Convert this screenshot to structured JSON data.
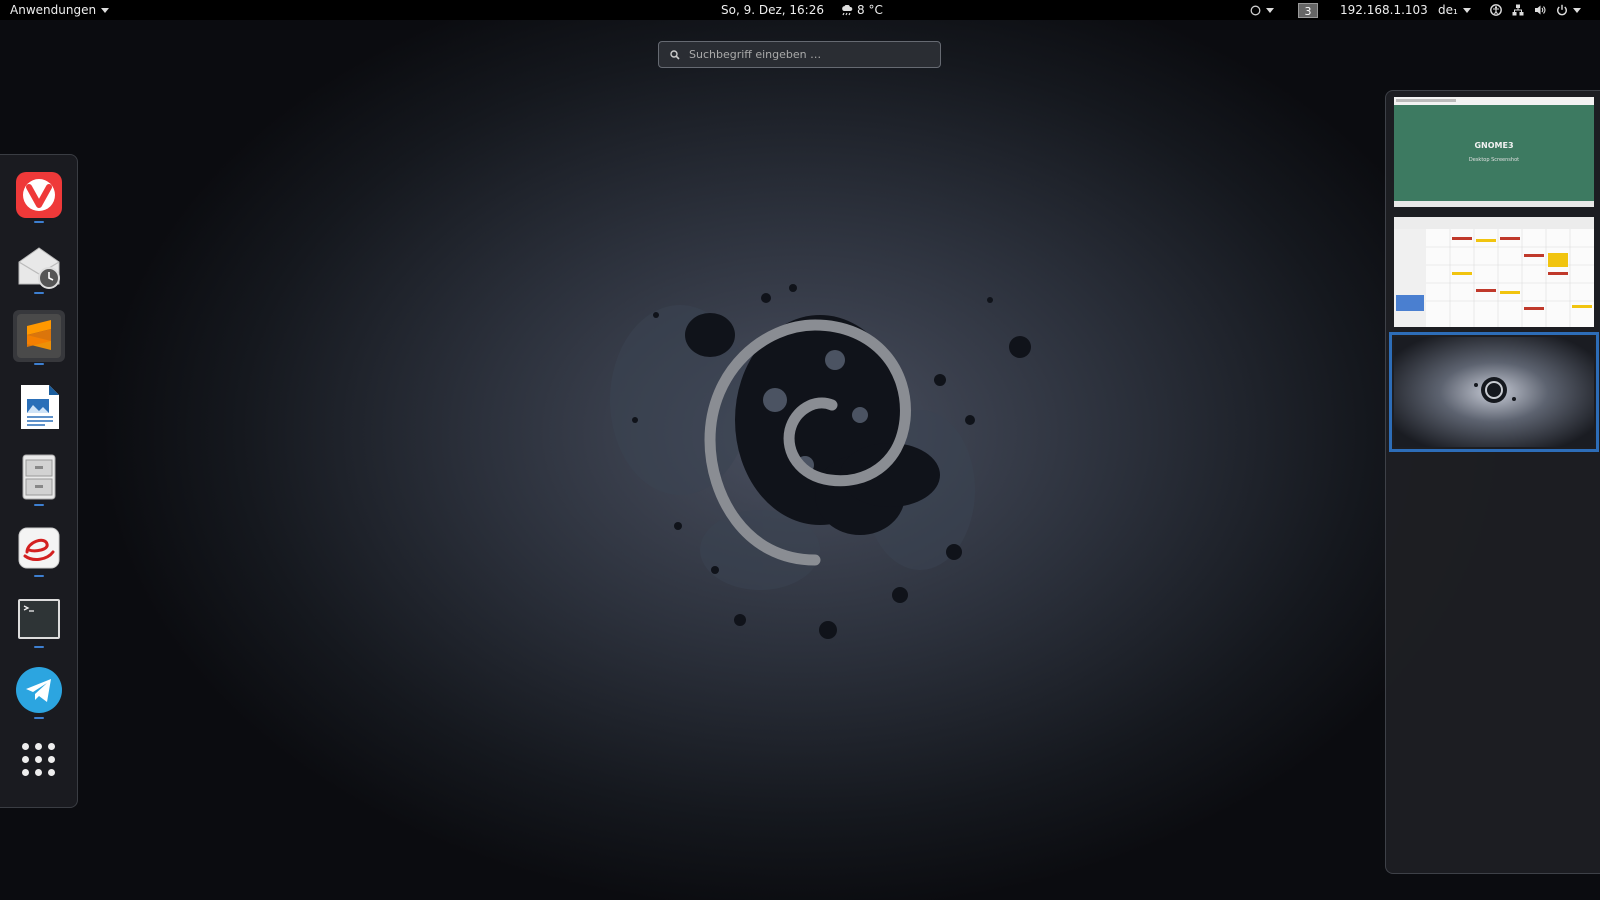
{
  "topbar": {
    "apps_menu": "Anwendungen",
    "clock": "So,  9. Dez, 16:26",
    "weather": "8 °C",
    "workspace_number": "3",
    "ip_address": "192.168.1.103",
    "keyboard_layout": "de₁"
  },
  "search": {
    "placeholder": "Suchbegriff eingeben …"
  },
  "dash": {
    "items": [
      {
        "name": "Vivaldi",
        "icon": "vivaldi-icon"
      },
      {
        "name": "Mail Notification",
        "icon": "mail-clock-icon"
      },
      {
        "name": "Sublime Text",
        "icon": "sublime-text-icon"
      },
      {
        "name": "LibreOffice Writer",
        "icon": "writer-icon"
      },
      {
        "name": "Files",
        "icon": "file-cabinet-icon"
      },
      {
        "name": "Evolution",
        "icon": "evolution-icon"
      },
      {
        "name": "Terminal",
        "icon": "terminal-icon"
      },
      {
        "name": "Telegram",
        "icon": "telegram-icon"
      },
      {
        "name": "Show Applications",
        "icon": "app-grid-icon"
      }
    ]
  },
  "workspaces": {
    "thumb1_title": "GNOME3",
    "thumb1_subtitle": "Desktop Screenshot",
    "active_index": 3
  },
  "colors": {
    "accent": "#2d6db8",
    "topbar": "#000000",
    "vivaldi": "#ef3939",
    "sublime": "#ff9800",
    "telegram": "#2ca5e0"
  }
}
